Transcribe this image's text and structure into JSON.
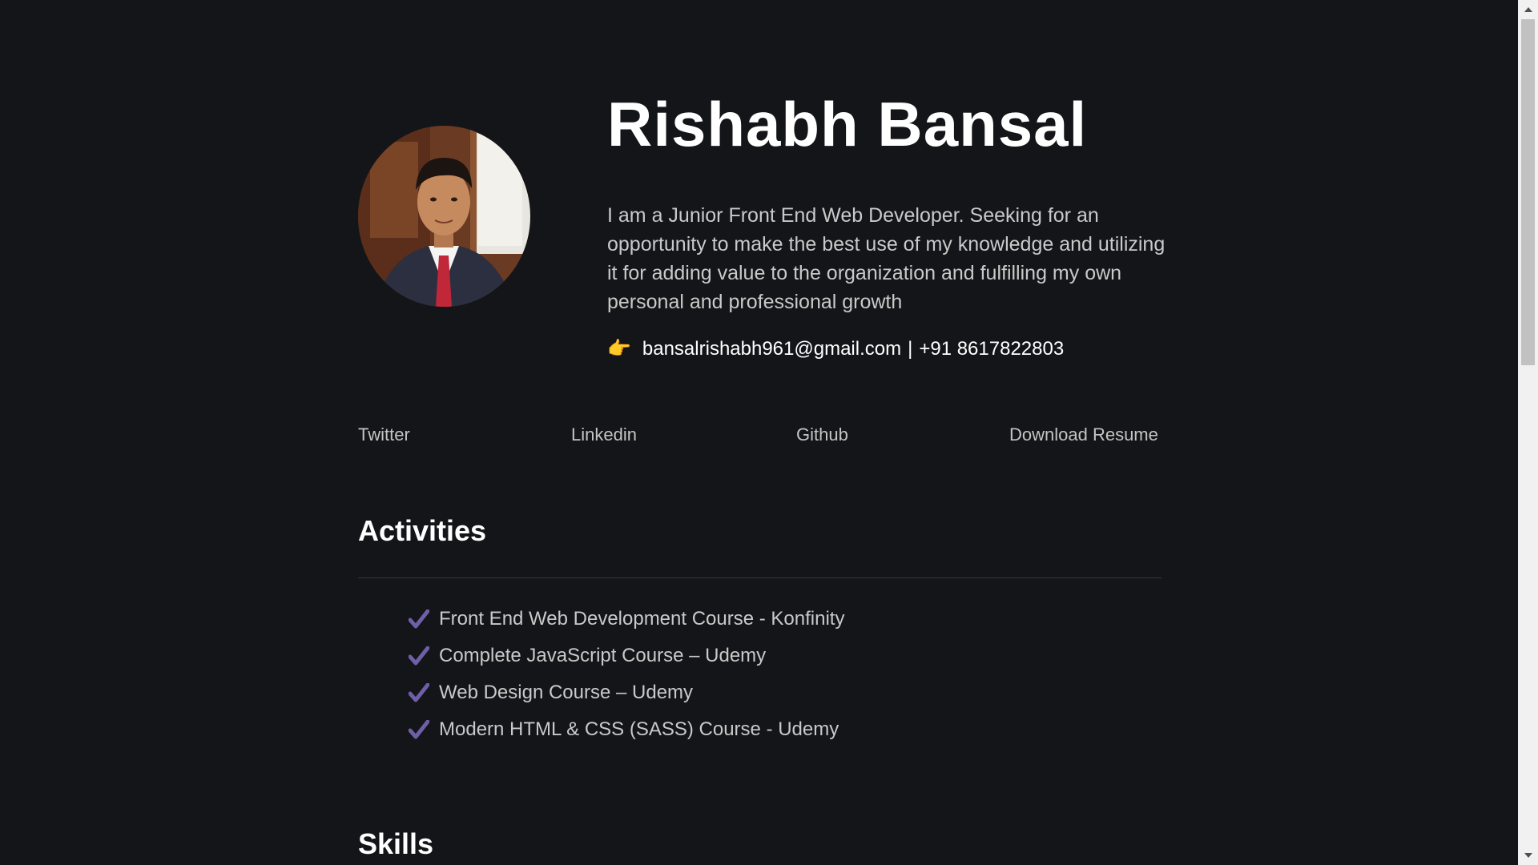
{
  "header": {
    "name": "Rishabh Bansal",
    "bio": "I am a Junior Front End Web Developer. Seeking for an opportunity to make the best use of my knowledge and utilizing it for adding value to the organization and fulfilling my own personal and professional growth",
    "contact_icon": "pointing-hand-icon",
    "contact_hand": "👉",
    "email": "bansalrishabh961@gmail.com",
    "separator": "|",
    "phone": "+91 8617822803"
  },
  "links": {
    "twitter": "Twitter",
    "linkedin": "Linkedin",
    "github": "Github",
    "resume": "Download Resume"
  },
  "activities": {
    "title": "Activities",
    "items": [
      {
        "label": "Front End Web Development Course - Konfinity"
      },
      {
        "label": "Complete JavaScript Course – Udemy"
      },
      {
        "label": "Web Design Course – Udemy"
      },
      {
        "label": "Modern HTML & CSS (SASS) Course - Udemy"
      }
    ]
  },
  "skills": {
    "title": "Skills"
  },
  "colors": {
    "background": "#141518",
    "check_accent": "#6e5fa6",
    "text_muted": "#c9c9c9"
  }
}
